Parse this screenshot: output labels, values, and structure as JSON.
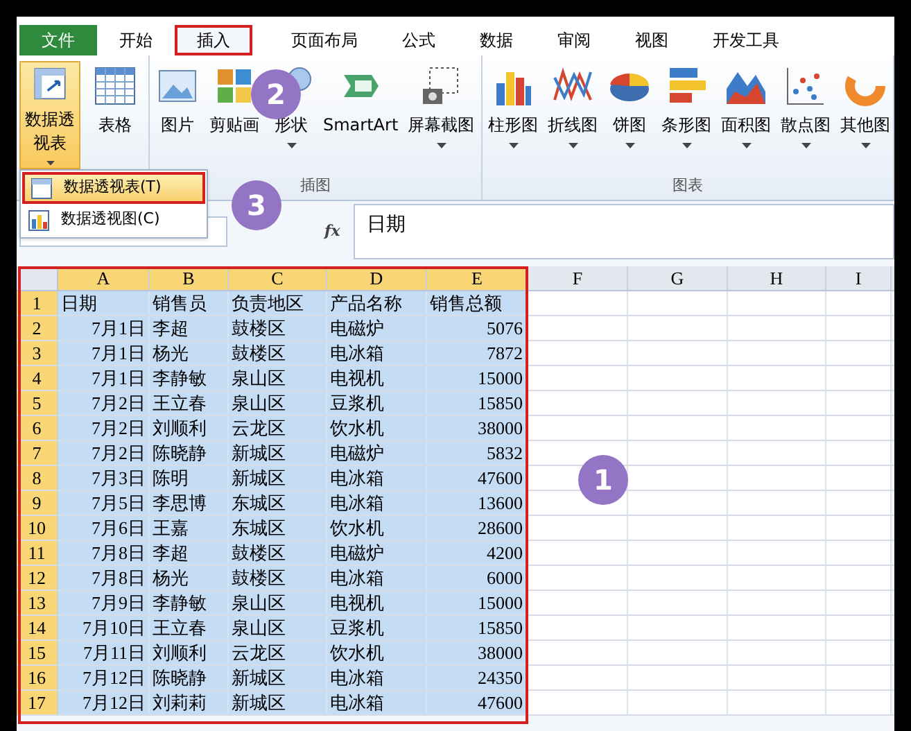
{
  "tabs": [
    {
      "label": "文件",
      "kind": "file",
      "selected": false,
      "outlined": false
    },
    {
      "label": "开始",
      "kind": "tab",
      "selected": false,
      "outlined": false
    },
    {
      "label": "插入",
      "kind": "tab",
      "selected": true,
      "outlined": true
    },
    {
      "label": "页面布局",
      "kind": "tab",
      "selected": false,
      "outlined": false
    },
    {
      "label": "公式",
      "kind": "tab",
      "selected": false,
      "outlined": false
    },
    {
      "label": "数据",
      "kind": "tab",
      "selected": false,
      "outlined": false
    },
    {
      "label": "审阅",
      "kind": "tab",
      "selected": false,
      "outlined": false
    },
    {
      "label": "视图",
      "kind": "tab",
      "selected": false,
      "outlined": false
    },
    {
      "label": "开发工具",
      "kind": "tab",
      "selected": false,
      "outlined": false
    }
  ],
  "ribbon": {
    "groups": [
      {
        "items": [
          {
            "label": "数据透视表",
            "dropdown": true,
            "selected": true
          },
          {
            "label": "表格",
            "dropdown": false,
            "selected": false
          }
        ]
      },
      {
        "label": "插图",
        "items": [
          {
            "label": "图片",
            "dropdown": false,
            "selected": false
          },
          {
            "label": "剪贴画",
            "dropdown": false,
            "selected": false
          },
          {
            "label": "形状",
            "dropdown": true,
            "selected": false
          },
          {
            "label": "SmartArt",
            "dropdown": false,
            "selected": false
          },
          {
            "label": "屏幕截图",
            "dropdown": true,
            "selected": false
          }
        ]
      },
      {
        "label": "图表",
        "items": [
          {
            "label": "柱形图",
            "dropdown": true,
            "selected": false
          },
          {
            "label": "折线图",
            "dropdown": true,
            "selected": false
          },
          {
            "label": "饼图",
            "dropdown": true,
            "selected": false
          },
          {
            "label": "条形图",
            "dropdown": true,
            "selected": false
          },
          {
            "label": "面积图",
            "dropdown": true,
            "selected": false
          },
          {
            "label": "散点图",
            "dropdown": true,
            "selected": false
          },
          {
            "label": "其他图",
            "dropdown": true,
            "selected": false
          }
        ]
      }
    ]
  },
  "menu": {
    "items": [
      {
        "label": "数据透视表(T)",
        "selected": true,
        "outlined": true
      },
      {
        "label": "数据透视图(C)",
        "selected": false,
        "outlined": false
      }
    ]
  },
  "formula_bar": {
    "fx": "fx",
    "value": "日期"
  },
  "sheet": {
    "outlined": true,
    "columns": [
      {
        "label": "A",
        "selected": true
      },
      {
        "label": "B",
        "selected": true
      },
      {
        "label": "C",
        "selected": true
      },
      {
        "label": "D",
        "selected": true
      },
      {
        "label": "E",
        "selected": true
      },
      {
        "label": "F",
        "selected": false
      },
      {
        "label": "G",
        "selected": false
      },
      {
        "label": "H",
        "selected": false
      },
      {
        "label": "I",
        "selected": false
      }
    ],
    "rows": [
      {
        "number": "1",
        "selected": true,
        "cells": [
          "日期",
          "销售员",
          "负责地区",
          "产品名称",
          "销售总额"
        ]
      },
      {
        "number": "2",
        "selected": true,
        "cells": [
          "7月1日",
          "李超",
          "鼓楼区",
          "电磁炉",
          "5076"
        ]
      },
      {
        "number": "3",
        "selected": true,
        "cells": [
          "7月1日",
          "杨光",
          "鼓楼区",
          "电冰箱",
          "7872"
        ]
      },
      {
        "number": "4",
        "selected": true,
        "cells": [
          "7月1日",
          "李静敏",
          "泉山区",
          "电视机",
          "15000"
        ]
      },
      {
        "number": "5",
        "selected": true,
        "cells": [
          "7月2日",
          "王立春",
          "泉山区",
          "豆浆机",
          "15850"
        ]
      },
      {
        "number": "6",
        "selected": true,
        "cells": [
          "7月2日",
          "刘顺利",
          "云龙区",
          "饮水机",
          "38000"
        ]
      },
      {
        "number": "7",
        "selected": true,
        "cells": [
          "7月2日",
          "陈晓静",
          "新城区",
          "电磁炉",
          "5832"
        ]
      },
      {
        "number": "8",
        "selected": true,
        "cells": [
          "7月3日",
          "陈明",
          "新城区",
          "电冰箱",
          "47600"
        ]
      },
      {
        "number": "9",
        "selected": true,
        "cells": [
          "7月5日",
          "李思博",
          "东城区",
          "电冰箱",
          "13600"
        ]
      },
      {
        "number": "10",
        "selected": true,
        "cells": [
          "7月6日",
          "王嘉",
          "东城区",
          "饮水机",
          "28600"
        ]
      },
      {
        "number": "11",
        "selected": true,
        "cells": [
          "7月8日",
          "李超",
          "鼓楼区",
          "电磁炉",
          "4200"
        ]
      },
      {
        "number": "12",
        "selected": true,
        "cells": [
          "7月8日",
          "杨光",
          "鼓楼区",
          "电冰箱",
          "6000"
        ]
      },
      {
        "number": "13",
        "selected": true,
        "cells": [
          "7月9日",
          "李静敏",
          "泉山区",
          "电视机",
          "15000"
        ]
      },
      {
        "number": "14",
        "selected": true,
        "cells": [
          "7月10日",
          "王立春",
          "泉山区",
          "豆浆机",
          "15850"
        ]
      },
      {
        "number": "15",
        "selected": true,
        "cells": [
          "7月11日",
          "刘顺利",
          "云龙区",
          "饮水机",
          "38000"
        ]
      },
      {
        "number": "16",
        "selected": true,
        "cells": [
          "7月12日",
          "陈晓静",
          "新城区",
          "电冰箱",
          "24350"
        ]
      },
      {
        "number": "17",
        "selected": true,
        "cells": [
          "7月12日",
          "刘莉莉",
          "新城区",
          "电冰箱",
          "47600"
        ]
      }
    ]
  },
  "annotations": [
    {
      "label": "2"
    },
    {
      "label": "3"
    },
    {
      "label": "1"
    }
  ]
}
